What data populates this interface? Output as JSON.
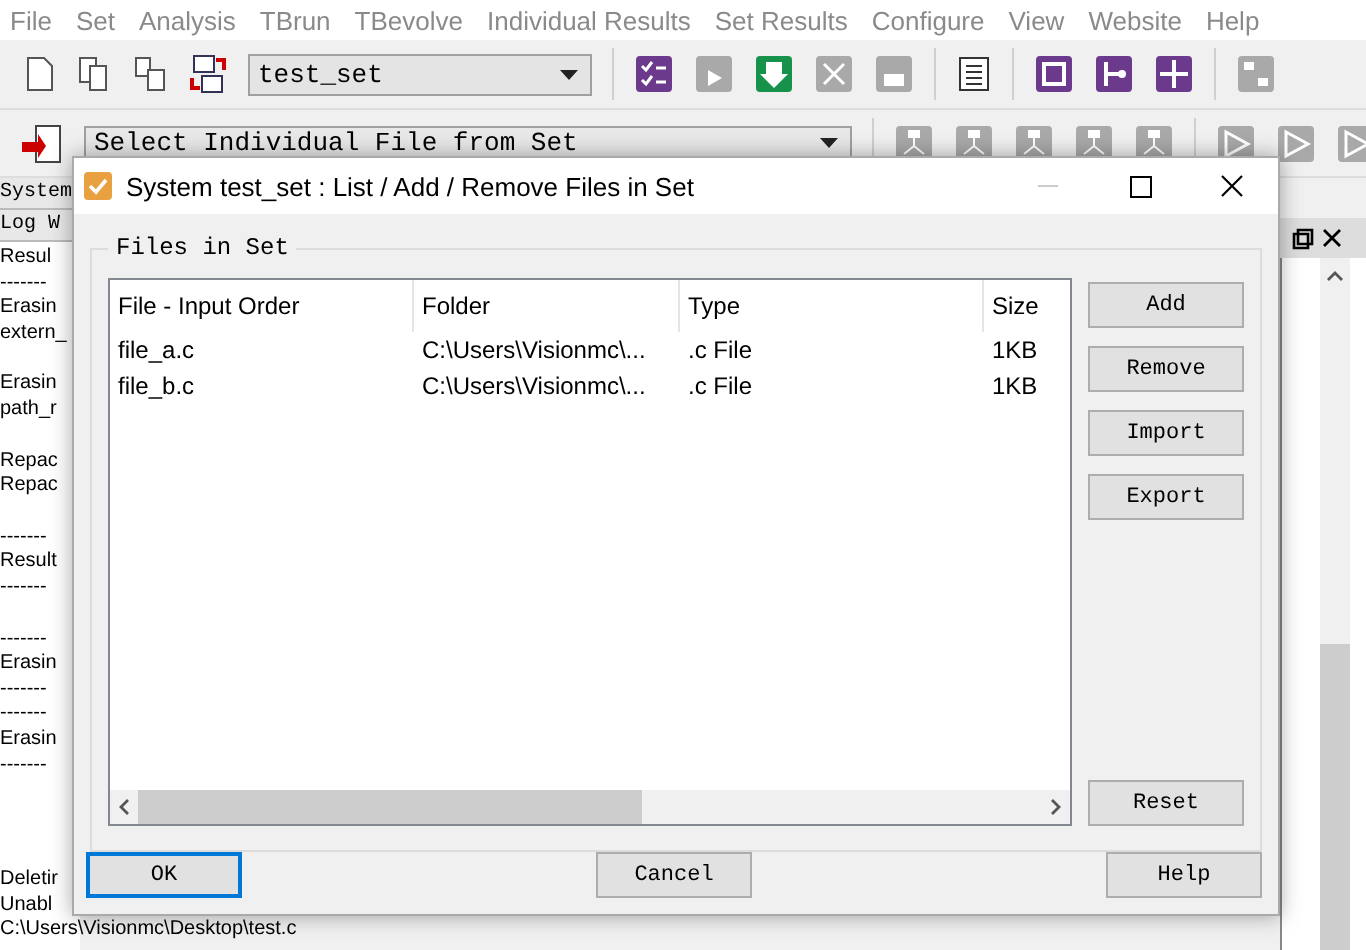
{
  "menu": [
    "File",
    "Set",
    "Analysis",
    "TBrun",
    "TBevolve",
    "Individual Results",
    "Set Results",
    "Configure",
    "View",
    "Website",
    "Help"
  ],
  "toolbar": {
    "set_combo": "test_set",
    "file_combo": "Select Individual File from Set"
  },
  "log_pane": {
    "tabs": [
      "System",
      "Log W"
    ],
    "blocks": [
      [
        "Resul",
        "-------",
        "Erasin",
        "extern_"
      ],
      [
        "Erasin",
        "path_r"
      ],
      [
        "Repac",
        "Repac"
      ],
      [
        "-------",
        "Result",
        "-------"
      ],
      [
        "-------",
        "Erasin",
        "-------",
        "-------",
        "Erasin",
        "-------"
      ]
    ],
    "footer": [
      "Deletir",
      "Unabl",
      "C:\\Users\\Visionmc\\Desktop\\test.c"
    ]
  },
  "dialog": {
    "title": "System test_set : List / Add / Remove Files in Set",
    "group_label": "Files in Set",
    "columns": [
      "File - Input Order",
      "Folder",
      "Type",
      "Size"
    ],
    "rows": [
      [
        "file_a.c",
        "C:\\Users\\Visionmc\\...",
        ".c File",
        "1KB"
      ],
      [
        "file_b.c",
        "C:\\Users\\Visionmc\\...",
        ".c File",
        "1KB"
      ]
    ],
    "side_buttons": [
      "Add",
      "Remove",
      "Import",
      "Export"
    ],
    "reset_button": "Reset",
    "footer_buttons": [
      {
        "label": "OK",
        "focused": true
      },
      {
        "label": "Cancel",
        "focused": false
      },
      {
        "label": "Help",
        "focused": false
      }
    ]
  }
}
